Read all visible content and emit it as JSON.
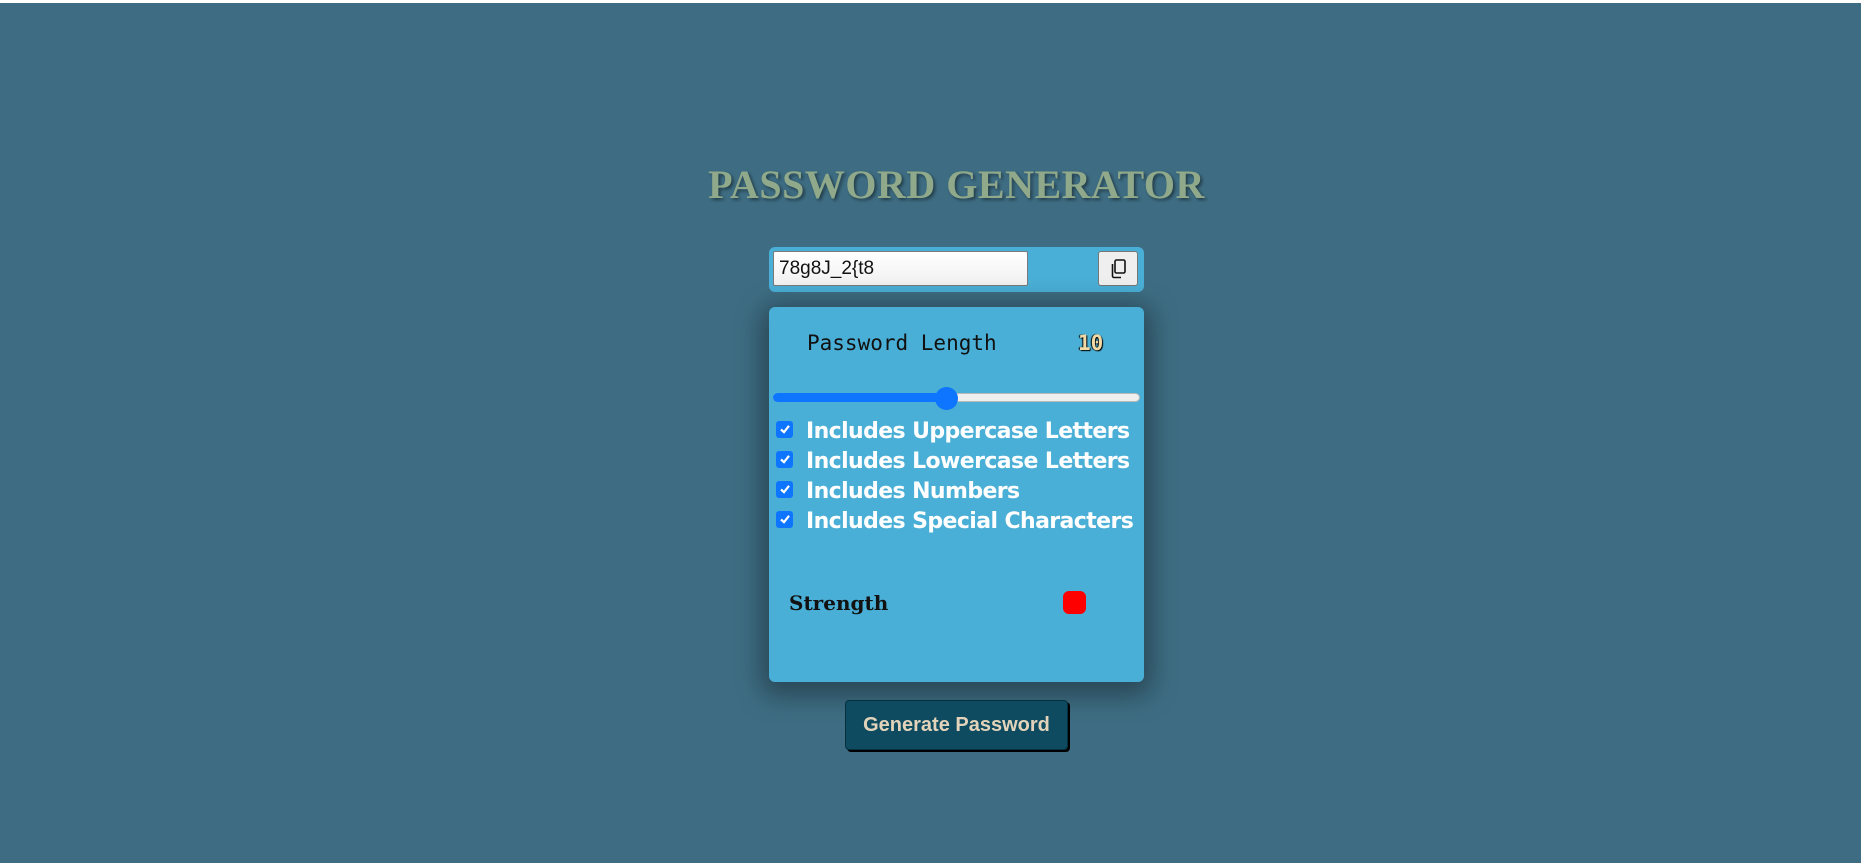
{
  "app": {
    "title": "PASSWORD GENERATOR"
  },
  "display": {
    "password": "78g8J_2{t8",
    "copy_icon": "copy-icon"
  },
  "length": {
    "label": "Password Length",
    "value": "10",
    "slider_fraction": 0.47
  },
  "options": [
    {
      "label": "Includes Uppercase Letters",
      "checked": true
    },
    {
      "label": "Includes Lowercase Letters",
      "checked": true
    },
    {
      "label": "Includes Numbers",
      "checked": true
    },
    {
      "label": "Includes Special Characters",
      "checked": true
    }
  ],
  "strength": {
    "label": "Strength",
    "color": "#ff0000"
  },
  "actions": {
    "generate_label": "Generate Password"
  },
  "colors": {
    "background": "#3e6d83",
    "panel": "#4aafd6",
    "accent": "#0d75ff",
    "title": "#8fa98a",
    "button": "#0e4b60"
  }
}
